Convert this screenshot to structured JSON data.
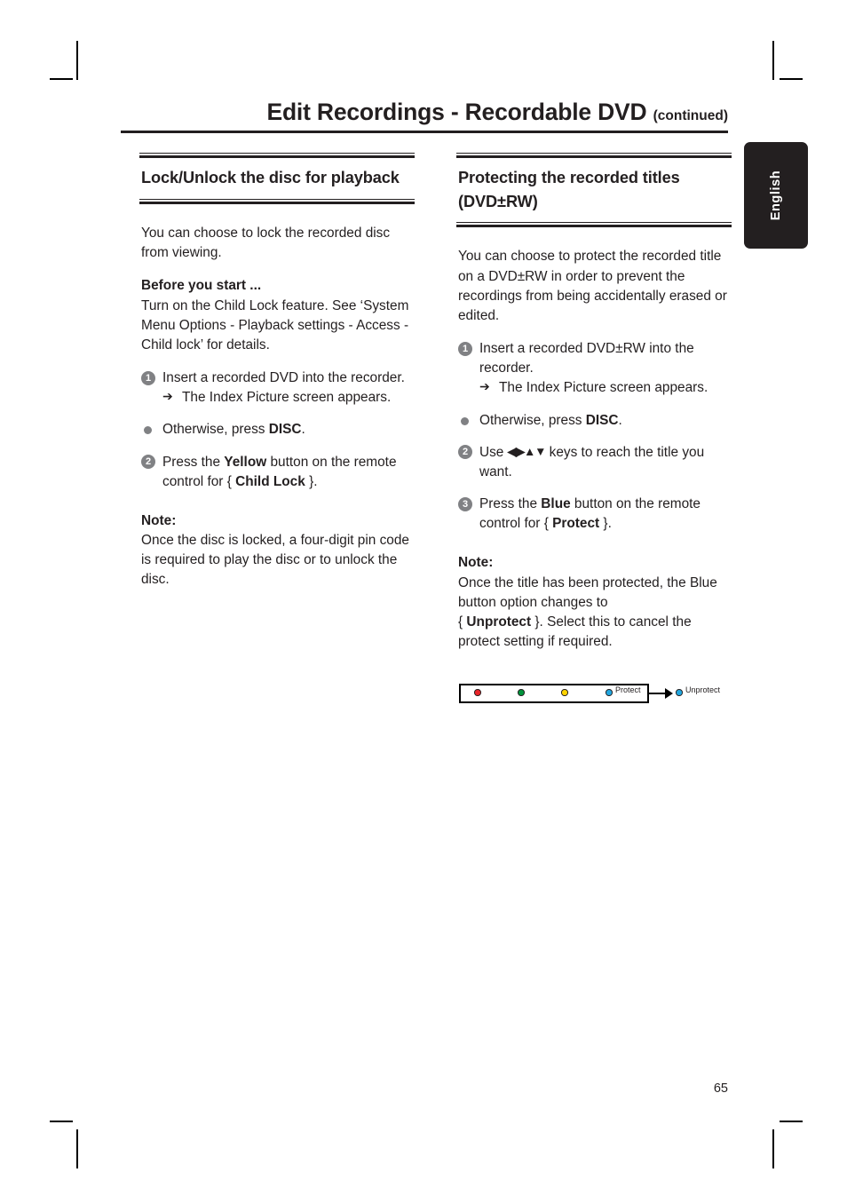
{
  "header": {
    "title": "Edit Recordings - Recordable DVD",
    "continued": "(continued)"
  },
  "language_tab": {
    "label": "English"
  },
  "left_column": {
    "heading": "Lock/Unlock the disc for playback",
    "intro": "You can choose to lock the recorded disc from viewing.",
    "before_you_start_heading": "Before you start ...",
    "before_you_start_text": "Turn on the Child Lock feature.  See ‘System Menu Options - Playback settings - Access - Child lock’ for details.",
    "steps": [
      {
        "marker": "1",
        "type": "number",
        "text": "Insert a recorded DVD into the recorder.",
        "result": "The Index Picture screen appears."
      },
      {
        "marker": "●",
        "type": "bullet",
        "text_before": "Otherwise, press ",
        "bold": "DISC",
        "text_after": "."
      },
      {
        "marker": "2",
        "type": "number",
        "text_before": "Press the ",
        "bold": "Yellow",
        "text_mid": " button on the remote control for { ",
        "bold2": "Child Lock",
        "text_after": " }."
      }
    ],
    "note_heading": "Note:",
    "note_text": "Once the disc is locked, a four-digit pin code is required to play the disc or to unlock the disc."
  },
  "right_column": {
    "heading": "Protecting the recorded titles (DVD±RW)",
    "intro": "You can choose to protect the recorded title on a DVD±RW in order to prevent the recordings from being accidentally erased or edited.",
    "steps": [
      {
        "marker": "1",
        "type": "number",
        "text": "Insert a recorded DVD±RW into the recorder.",
        "result": "The Index Picture screen appears."
      },
      {
        "marker": "●",
        "type": "bullet",
        "text_before": "Otherwise, press ",
        "bold": "DISC",
        "text_after": "."
      },
      {
        "marker": "2",
        "type": "number",
        "text_before": "Use ",
        "keys": "◀▶▲▼",
        "text_after": " keys to reach the title you want."
      },
      {
        "marker": "3",
        "type": "number",
        "text_before": "Press the ",
        "bold": "Blue",
        "text_mid": " button on the remote control for { ",
        "bold2": "Protect",
        "text_after": " }."
      }
    ],
    "note_heading": "Note:",
    "note_text_1": "Once the title has been protected, the Blue button option changes to",
    "note_brace_open": "{ ",
    "note_bold": "Unprotect",
    "note_text_2": " }.  Select this to cancel the protect setting if required."
  },
  "diagram": {
    "keys": [
      {
        "name": "red-key",
        "color": "#e8242a",
        "label": ""
      },
      {
        "name": "green-key",
        "color": "#00933b",
        "label": ""
      },
      {
        "name": "yellow-key",
        "color": "#ffd400",
        "label": ""
      },
      {
        "name": "blue-key",
        "color": "#22a7e0",
        "label": "Protect"
      }
    ],
    "result_key": {
      "name": "blue-key-after",
      "color": "#22a7e0",
      "label": "Unprotect"
    }
  },
  "footer": {
    "page_number": "65"
  },
  "arrow_glyph": "➔"
}
